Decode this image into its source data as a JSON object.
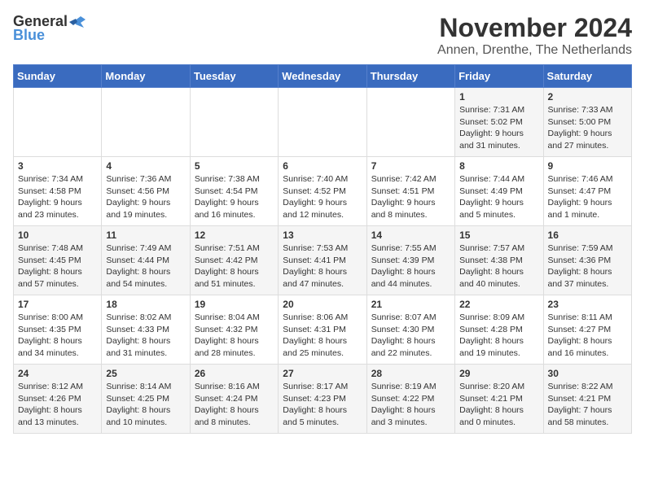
{
  "header": {
    "logo_general": "General",
    "logo_blue": "Blue",
    "title": "November 2024",
    "location": "Annen, Drenthe, The Netherlands"
  },
  "days_of_week": [
    "Sunday",
    "Monday",
    "Tuesday",
    "Wednesday",
    "Thursday",
    "Friday",
    "Saturday"
  ],
  "weeks": [
    [
      {
        "day": "",
        "info": ""
      },
      {
        "day": "",
        "info": ""
      },
      {
        "day": "",
        "info": ""
      },
      {
        "day": "",
        "info": ""
      },
      {
        "day": "",
        "info": ""
      },
      {
        "day": "1",
        "info": "Sunrise: 7:31 AM\nSunset: 5:02 PM\nDaylight: 9 hours\nand 31 minutes."
      },
      {
        "day": "2",
        "info": "Sunrise: 7:33 AM\nSunset: 5:00 PM\nDaylight: 9 hours\nand 27 minutes."
      }
    ],
    [
      {
        "day": "3",
        "info": "Sunrise: 7:34 AM\nSunset: 4:58 PM\nDaylight: 9 hours\nand 23 minutes."
      },
      {
        "day": "4",
        "info": "Sunrise: 7:36 AM\nSunset: 4:56 PM\nDaylight: 9 hours\nand 19 minutes."
      },
      {
        "day": "5",
        "info": "Sunrise: 7:38 AM\nSunset: 4:54 PM\nDaylight: 9 hours\nand 16 minutes."
      },
      {
        "day": "6",
        "info": "Sunrise: 7:40 AM\nSunset: 4:52 PM\nDaylight: 9 hours\nand 12 minutes."
      },
      {
        "day": "7",
        "info": "Sunrise: 7:42 AM\nSunset: 4:51 PM\nDaylight: 9 hours\nand 8 minutes."
      },
      {
        "day": "8",
        "info": "Sunrise: 7:44 AM\nSunset: 4:49 PM\nDaylight: 9 hours\nand 5 minutes."
      },
      {
        "day": "9",
        "info": "Sunrise: 7:46 AM\nSunset: 4:47 PM\nDaylight: 9 hours\nand 1 minute."
      }
    ],
    [
      {
        "day": "10",
        "info": "Sunrise: 7:48 AM\nSunset: 4:45 PM\nDaylight: 8 hours\nand 57 minutes."
      },
      {
        "day": "11",
        "info": "Sunrise: 7:49 AM\nSunset: 4:44 PM\nDaylight: 8 hours\nand 54 minutes."
      },
      {
        "day": "12",
        "info": "Sunrise: 7:51 AM\nSunset: 4:42 PM\nDaylight: 8 hours\nand 51 minutes."
      },
      {
        "day": "13",
        "info": "Sunrise: 7:53 AM\nSunset: 4:41 PM\nDaylight: 8 hours\nand 47 minutes."
      },
      {
        "day": "14",
        "info": "Sunrise: 7:55 AM\nSunset: 4:39 PM\nDaylight: 8 hours\nand 44 minutes."
      },
      {
        "day": "15",
        "info": "Sunrise: 7:57 AM\nSunset: 4:38 PM\nDaylight: 8 hours\nand 40 minutes."
      },
      {
        "day": "16",
        "info": "Sunrise: 7:59 AM\nSunset: 4:36 PM\nDaylight: 8 hours\nand 37 minutes."
      }
    ],
    [
      {
        "day": "17",
        "info": "Sunrise: 8:00 AM\nSunset: 4:35 PM\nDaylight: 8 hours\nand 34 minutes."
      },
      {
        "day": "18",
        "info": "Sunrise: 8:02 AM\nSunset: 4:33 PM\nDaylight: 8 hours\nand 31 minutes."
      },
      {
        "day": "19",
        "info": "Sunrise: 8:04 AM\nSunset: 4:32 PM\nDaylight: 8 hours\nand 28 minutes."
      },
      {
        "day": "20",
        "info": "Sunrise: 8:06 AM\nSunset: 4:31 PM\nDaylight: 8 hours\nand 25 minutes."
      },
      {
        "day": "21",
        "info": "Sunrise: 8:07 AM\nSunset: 4:30 PM\nDaylight: 8 hours\nand 22 minutes."
      },
      {
        "day": "22",
        "info": "Sunrise: 8:09 AM\nSunset: 4:28 PM\nDaylight: 8 hours\nand 19 minutes."
      },
      {
        "day": "23",
        "info": "Sunrise: 8:11 AM\nSunset: 4:27 PM\nDaylight: 8 hours\nand 16 minutes."
      }
    ],
    [
      {
        "day": "24",
        "info": "Sunrise: 8:12 AM\nSunset: 4:26 PM\nDaylight: 8 hours\nand 13 minutes."
      },
      {
        "day": "25",
        "info": "Sunrise: 8:14 AM\nSunset: 4:25 PM\nDaylight: 8 hours\nand 10 minutes."
      },
      {
        "day": "26",
        "info": "Sunrise: 8:16 AM\nSunset: 4:24 PM\nDaylight: 8 hours\nand 8 minutes."
      },
      {
        "day": "27",
        "info": "Sunrise: 8:17 AM\nSunset: 4:23 PM\nDaylight: 8 hours\nand 5 minutes."
      },
      {
        "day": "28",
        "info": "Sunrise: 8:19 AM\nSunset: 4:22 PM\nDaylight: 8 hours\nand 3 minutes."
      },
      {
        "day": "29",
        "info": "Sunrise: 8:20 AM\nSunset: 4:21 PM\nDaylight: 8 hours\nand 0 minutes."
      },
      {
        "day": "30",
        "info": "Sunrise: 8:22 AM\nSunset: 4:21 PM\nDaylight: 7 hours\nand 58 minutes."
      }
    ]
  ]
}
